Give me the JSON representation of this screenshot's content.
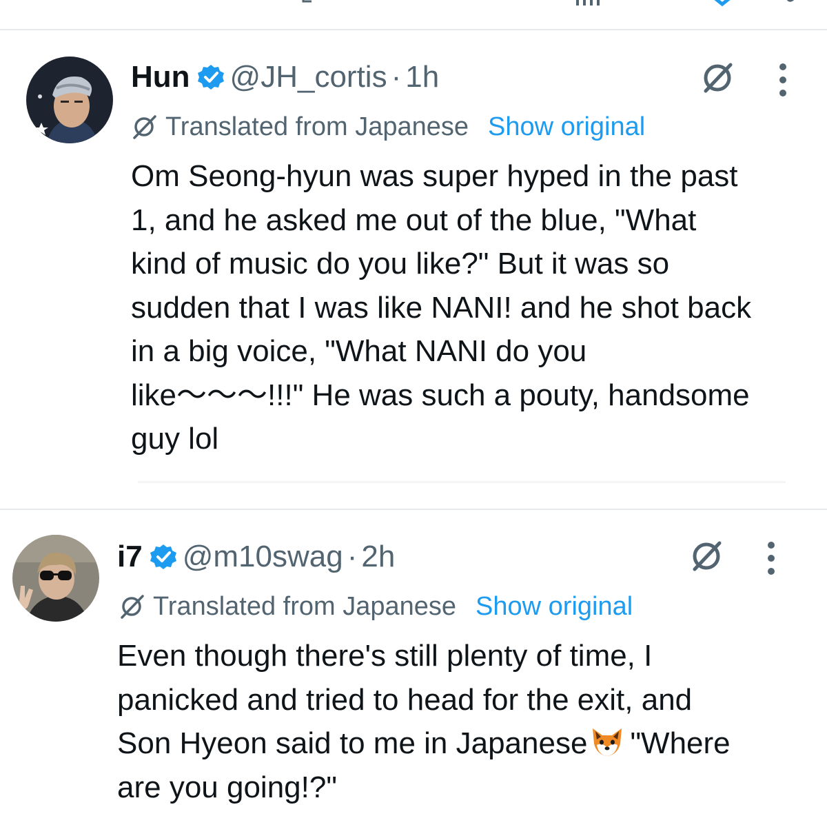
{
  "tweets": [
    {
      "name": "Hun",
      "handle": "@JH_cortis",
      "separator": "·",
      "time": "1h",
      "translated_label": "Translated from Japanese",
      "show_original_label": "Show original",
      "body_lines": [
        "Om Seong-hyun was super hyped in the past",
        "1, and he asked me out of the blue, \"What",
        "kind of music do you like?\" But it was so",
        "sudden that I was like NANI! and he shot back",
        "in a big voice, \"What NANI do you",
        "like〜〜〜!!!\" He was such a pouty, handsome",
        "guy lol"
      ]
    },
    {
      "name": "i7",
      "handle": "@m10swag",
      "separator": "·",
      "time": "2h",
      "translated_label": "Translated from Japanese",
      "show_original_label": "Show original",
      "body_lines": [
        "Even though there's still plenty of time, I",
        "panicked and tried to head for the exit, and",
        "Son Hyeon said to me in Japanese",
        "\"Where",
        "are you going!?\""
      ]
    }
  ],
  "icons": {
    "verified": "verified-badge-icon",
    "grok": "grok-icon",
    "more": "more-options-icon",
    "translate": "translate-icon",
    "emoji": "fox-face-emoji"
  },
  "colors": {
    "text": "#0f1419",
    "secondary": "#536471",
    "link": "#1d9bf0",
    "verified": "#1d9bf0",
    "divider": "#e6e9ec"
  }
}
